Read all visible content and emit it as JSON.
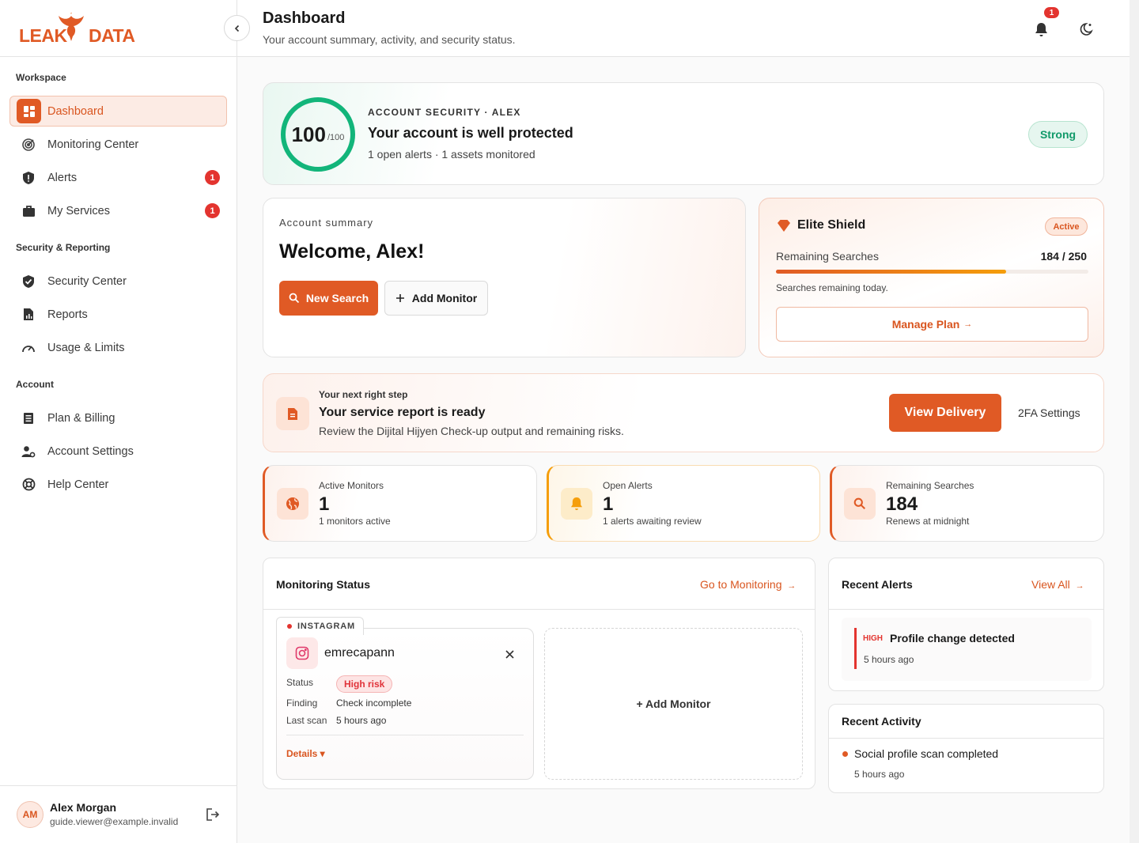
{
  "brand": {
    "logo_left": "LEAK",
    "logo_right": "DATA",
    "accent": "#e05a25"
  },
  "sidebar": {
    "sections": [
      {
        "title": "Workspace"
      },
      {
        "title": "Security & Reporting"
      },
      {
        "title": "Account"
      }
    ],
    "items": [
      {
        "label": "Dashboard",
        "icon": "dashboard-icon",
        "active": true
      },
      {
        "label": "Monitoring Center",
        "icon": "radar-icon"
      },
      {
        "label": "Alerts",
        "icon": "shield-alert-icon",
        "badge": "1"
      },
      {
        "label": "My Services",
        "icon": "briefcase-icon",
        "badge": "1"
      },
      {
        "label": "Security Center",
        "icon": "shield-check-icon"
      },
      {
        "label": "Reports",
        "icon": "report-icon"
      },
      {
        "label": "Usage & Limits",
        "icon": "gauge-icon"
      },
      {
        "label": "Plan & Billing",
        "icon": "billing-icon"
      },
      {
        "label": "Account Settings",
        "icon": "user-gear-icon"
      },
      {
        "label": "Help Center",
        "icon": "lifebuoy-icon"
      }
    ],
    "user": {
      "initials": "AM",
      "name": "Alex Morgan",
      "email": "guide.viewer@example.invalid"
    }
  },
  "header": {
    "title": "Dashboard",
    "subtitle": "Your account summary, activity, and security status.",
    "notification_count": "1"
  },
  "security": {
    "score": "100",
    "score_max": "/100",
    "score_fraction": 1.0,
    "eyebrow": "ACCOUNT SECURITY · ALEX",
    "title": "Your account is well protected",
    "subtitle": "1 open alerts · 1 assets monitored",
    "status": "Strong"
  },
  "summary": {
    "eyebrow": "Account summary",
    "welcome": "Welcome, Alex!",
    "new_search": "New Search",
    "add_monitor": "Add Monitor"
  },
  "plan": {
    "name": "Elite Shield",
    "status": "Active",
    "searches_label": "Remaining Searches",
    "searches_value": "184 / 250",
    "searches_fraction": 0.736,
    "note": "Searches remaining today.",
    "manage": "Manage Plan",
    "manage_arrow": "→"
  },
  "next_step": {
    "eyebrow": "Your next right step",
    "title": "Your service report is ready",
    "desc": "Review the Dijital Hijyen Check-up output and remaining risks.",
    "primary": "View Delivery",
    "secondary": "2FA Settings"
  },
  "stats": [
    {
      "label": "Active Monitors",
      "value": "1",
      "sub": "1 monitors active",
      "icon": "globe-icon",
      "color": "#e05a25"
    },
    {
      "label": "Open Alerts",
      "value": "1",
      "sub": "1 alerts awaiting review",
      "icon": "bell-icon",
      "color": "#f59e0b"
    },
    {
      "label": "Remaining Searches",
      "value": "184",
      "sub": "Renews at midnight",
      "icon": "search-icon",
      "color": "#e05a25"
    }
  ],
  "monitoring": {
    "title": "Monitoring Status",
    "link": "Go to Monitoring",
    "link_arrow": "→",
    "item": {
      "platform": "INSTAGRAM",
      "username": "emrecapann",
      "status_label": "Status",
      "status_value": "High risk",
      "finding_label": "Finding",
      "finding_value": "Check incomplete",
      "scan_label": "Last scan",
      "scan_value": "5 hours ago",
      "details": "Details ▾"
    },
    "add": "+ Add Monitor"
  },
  "alerts": {
    "title": "Recent Alerts",
    "link": "View All",
    "link_arrow": "→",
    "items": [
      {
        "severity": "HIGH",
        "title": "Profile change detected",
        "time": "5 hours ago"
      }
    ]
  },
  "activity": {
    "title": "Recent Activity",
    "items": [
      {
        "title": "Social profile scan completed",
        "time": "5 hours ago"
      }
    ]
  }
}
